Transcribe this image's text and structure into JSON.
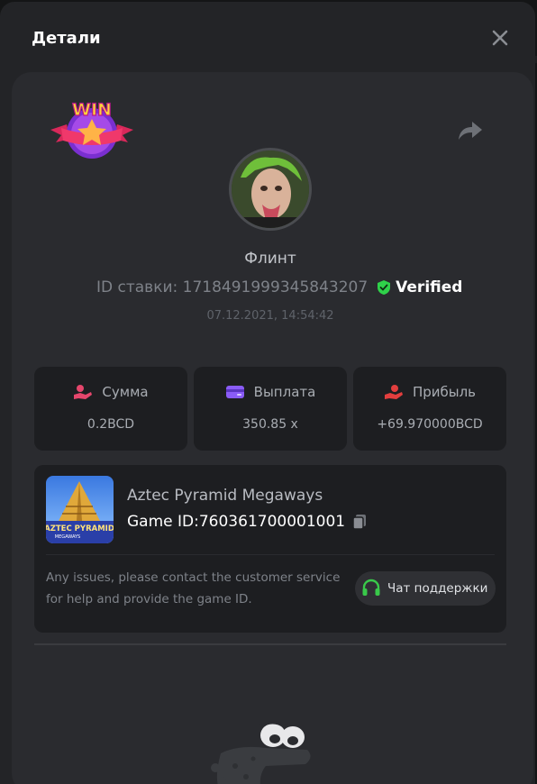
{
  "backdrop": {
    "fragment": "G"
  },
  "modal": {
    "title": "Детали"
  },
  "player": {
    "name": "Флинт"
  },
  "bet": {
    "label": "ID ставки:",
    "id": "1718491999345843207",
    "verified_label": "Verified",
    "datetime": "07.12.2021, 14:54:42"
  },
  "stats": [
    {
      "label": "Сумма",
      "value": "0.2BCD",
      "icon": "coins-hand-icon",
      "color": "#e5466c"
    },
    {
      "label": "Выплата",
      "value": "350.85 x",
      "icon": "wallet-card-icon",
      "color": "#8a5cf6"
    },
    {
      "label": "Прибыль",
      "value": "+69.970000BCD",
      "icon": "profit-hand-icon",
      "color": "#e23e3e"
    }
  ],
  "game": {
    "name": "Aztec Pyramid Megaways",
    "id_label": "Game ID:",
    "id": "760361700001001",
    "thumb_title": "AZTEC PYRAMID",
    "thumb_sub": "MEGAWAYS",
    "help_text": "Any issues, please contact the customer service for help and provide the game ID.",
    "support_label": "Чат поддержки"
  },
  "badge": {
    "text": "WIN"
  },
  "colors": {
    "verified": "#2fd14a",
    "support_icon": "#39c94a",
    "accent_pink": "#e5466c"
  }
}
